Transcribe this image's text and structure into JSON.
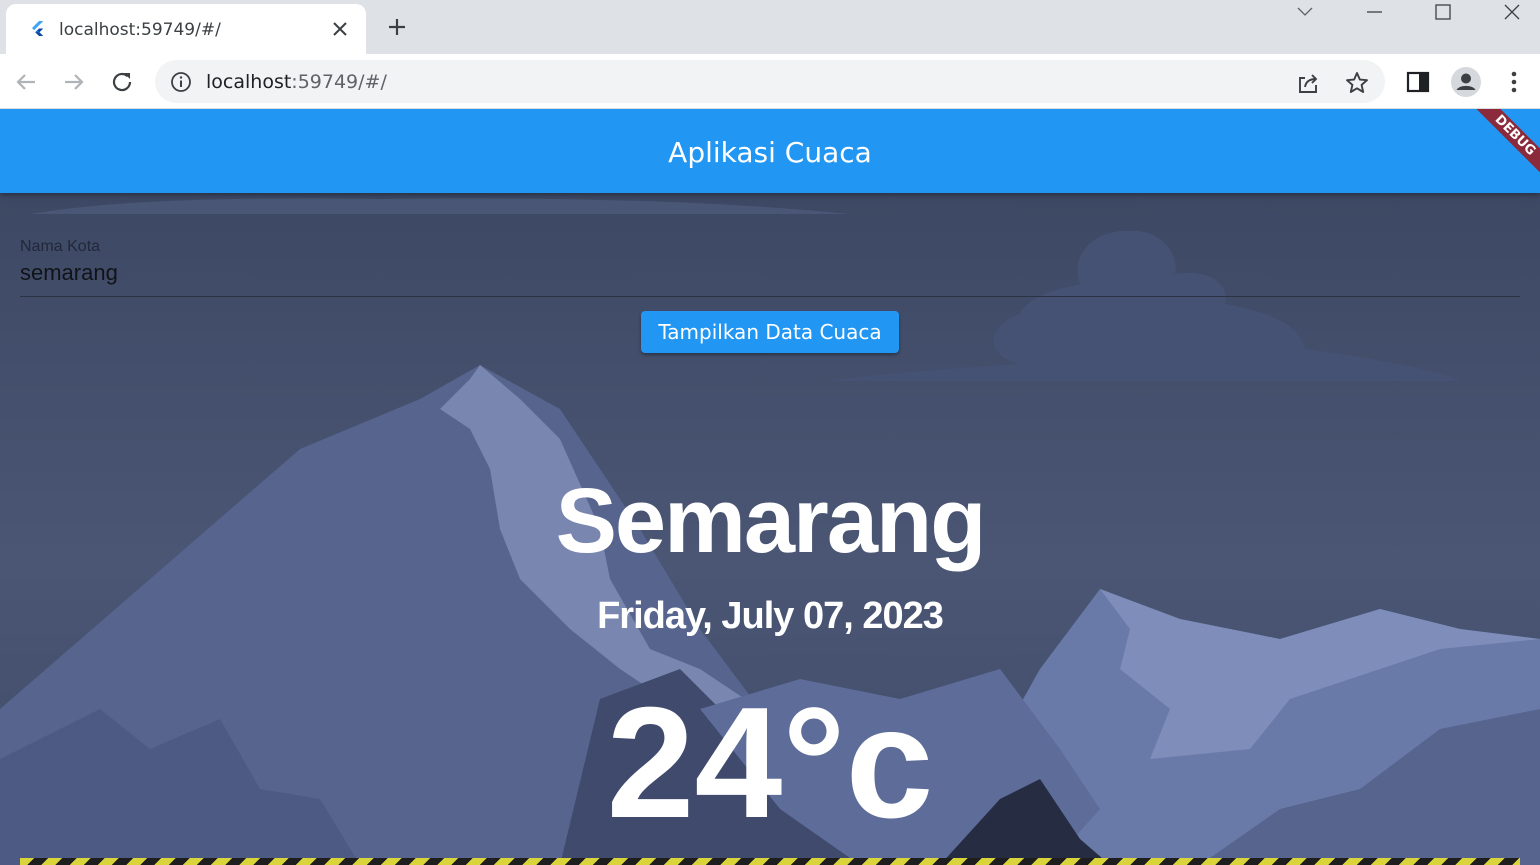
{
  "browser": {
    "tab_title": "localhost:59749/#/",
    "url_host": "localhost",
    "url_rest": ":59749/#/"
  },
  "app": {
    "title": "Aplikasi Cuaca",
    "debug_label": "DEBUG",
    "primary_color": "#2196f3",
    "form": {
      "label": "Nama Kota",
      "value": "semarang"
    },
    "button_label": "Tampilkan Data Cuaca",
    "weather": {
      "city": "Semarang",
      "date": "Friday, July 07, 2023",
      "temperature": "24°c"
    }
  },
  "icons": [
    "flutter-icon",
    "close-icon",
    "plus-icon",
    "back-arrow-icon",
    "forward-arrow-icon",
    "reload-icon",
    "info-icon",
    "share-icon",
    "star-icon",
    "side-panel-icon",
    "profile-icon",
    "more-vert-icon",
    "minimize-icon",
    "maximize-icon",
    "window-close-icon",
    "tab-search-icon"
  ]
}
